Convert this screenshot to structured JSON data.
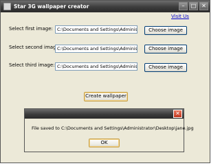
{
  "window": {
    "title": "Star 3G wallpaper creator",
    "minimize_glyph": "–",
    "maximize_glyph": "□",
    "close_glyph": "✕"
  },
  "visit_link": "Visit Us",
  "rows": [
    {
      "label": "Select first image:",
      "path": "C:\\Documents and Settings\\Administr",
      "button": "Choose image"
    },
    {
      "label": "Select second image:",
      "path": "C:\\Documents and Settings\\Administr",
      "button": "Choose image"
    },
    {
      "label": "Select third image:",
      "path": "C:\\Documents and Settings\\Administr",
      "button": "Choose image"
    }
  ],
  "create_button": "Create wallpaper",
  "dialog": {
    "close_glyph": "✕",
    "message": "File saved to C:\\Documents and Settings\\Administrator\\Desktop\\jane.jpg",
    "ok_label": "OK"
  }
}
